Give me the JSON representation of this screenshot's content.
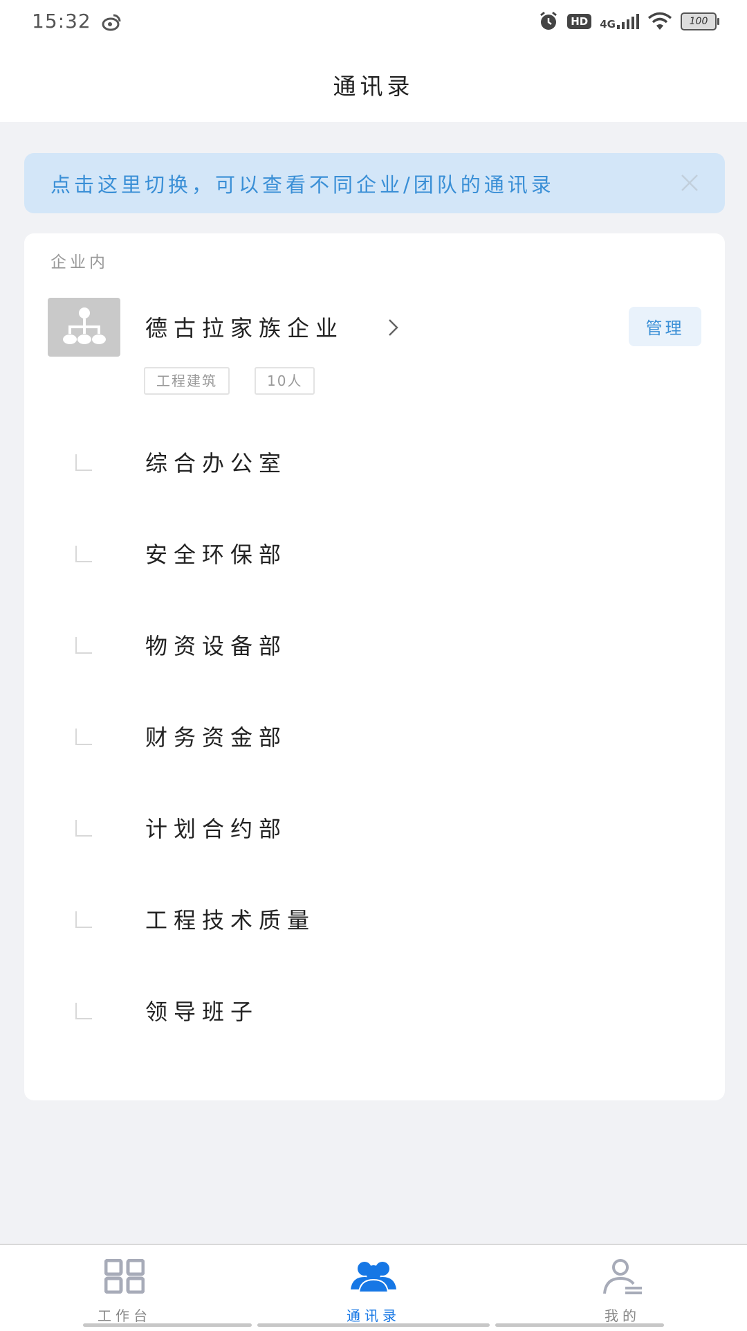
{
  "status_bar": {
    "time": "15:32",
    "hd": "HD",
    "network": "4G",
    "battery": "100"
  },
  "header": {
    "title": "通讯录"
  },
  "tip_banner": {
    "text": "点击这里切换，可以查看不同企业/团队的通讯录"
  },
  "org_section": {
    "label": "企业内",
    "name": "德古拉家族企业",
    "manage_label": "管理",
    "tags": [
      "工程建筑",
      "10人"
    ],
    "departments": [
      "综合办公室",
      "安全环保部",
      "物资设备部",
      "财务资金部",
      "计划合约部",
      "工程技术质量",
      "领导班子"
    ]
  },
  "tabbar": {
    "tabs": [
      {
        "label": "工作台",
        "icon": "grid-icon",
        "active": false
      },
      {
        "label": "通讯录",
        "icon": "contacts-icon",
        "active": true
      },
      {
        "label": "我的",
        "icon": "profile-icon",
        "active": false
      }
    ]
  },
  "colors": {
    "accent": "#1677e5",
    "tip_bg": "#d3e6f8",
    "tip_text": "#3a8fd6",
    "page_bg": "#f1f2f5"
  }
}
